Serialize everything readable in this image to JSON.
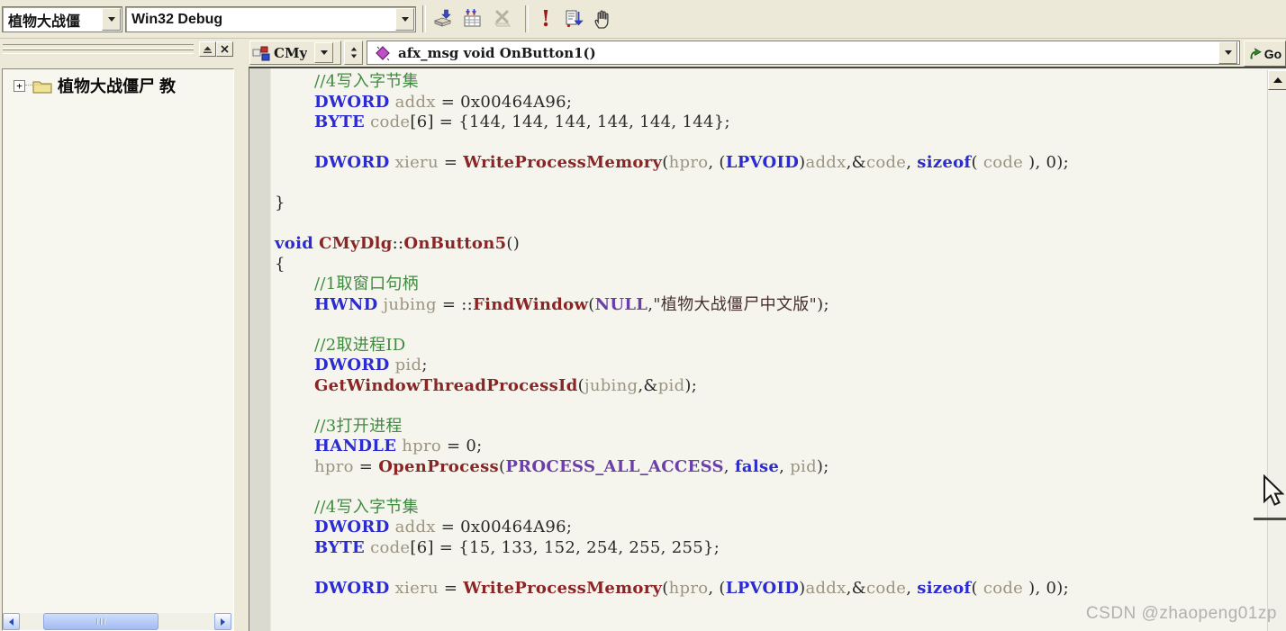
{
  "toolbar": {
    "project_combo_value": "植物大战僵",
    "config_combo_value": "Win32 Debug",
    "icon_names": [
      "build-icon",
      "build-all-icon",
      "stop-build-icon",
      "execute-program-icon",
      "go-debug-icon",
      "hand-breakpoint-icon"
    ]
  },
  "wizardbar": {
    "class_combo_value": "CMy",
    "member_combo_value": "afx_msg void OnButton1()",
    "go_label": "Go",
    "icon_names": [
      "class-icon",
      "member-function-icon",
      "go-arrow-icon"
    ]
  },
  "workspace_tree": {
    "root_label": "植物大战僵尸 教"
  },
  "editor": {
    "syntax_colors": {
      "keyword": "#2B2BD0",
      "function": "#8B2525",
      "identifier": "#9C9480",
      "plain": "#2A2A28",
      "comment": "#3E8A3E",
      "macro": "#6B3FA8",
      "string": "#46302E",
      "background": "#F5F5EE"
    },
    "lines": [
      {
        "ind": 1,
        "t": [
          [
            "c",
            "//4写入字节集"
          ]
        ]
      },
      {
        "ind": 1,
        "t": [
          [
            "k",
            "DWORD"
          ],
          [
            "i",
            " addx "
          ],
          [
            "p",
            "= 0x00464A96;"
          ]
        ]
      },
      {
        "ind": 1,
        "t": [
          [
            "k",
            "BYTE"
          ],
          [
            "i",
            " code"
          ],
          [
            "p",
            "[6] = {144, 144, 144, 144, 144, 144};"
          ]
        ]
      },
      {
        "t": []
      },
      {
        "ind": 1,
        "t": [
          [
            "k",
            "DWORD"
          ],
          [
            "i",
            " xieru "
          ],
          [
            "p",
            "= "
          ],
          [
            "f",
            "WriteProcessMemory"
          ],
          [
            "p",
            "("
          ],
          [
            "i",
            "hpro"
          ],
          [
            "p",
            ", ("
          ],
          [
            "k",
            "LPVOID"
          ],
          [
            "p",
            ")"
          ],
          [
            "i",
            "addx"
          ],
          [
            "p",
            ",&"
          ],
          [
            "i",
            "code"
          ],
          [
            "p",
            ", "
          ],
          [
            "k",
            "sizeof"
          ],
          [
            "p",
            "( "
          ],
          [
            "i",
            "code"
          ],
          [
            "p",
            " ), 0);"
          ]
        ]
      },
      {
        "t": []
      },
      {
        "t": [
          [
            "p",
            "}"
          ]
        ]
      },
      {
        "t": []
      },
      {
        "t": [
          [
            "k",
            "void"
          ],
          [
            "p",
            " "
          ],
          [
            "f",
            "CMyDlg"
          ],
          [
            "p",
            "::"
          ],
          [
            "f",
            "OnButton5"
          ],
          [
            "p",
            "()"
          ]
        ]
      },
      {
        "t": [
          [
            "p",
            "{"
          ]
        ]
      },
      {
        "ind": 1,
        "t": [
          [
            "c",
            "//1取窗口句柄"
          ]
        ]
      },
      {
        "ind": 1,
        "t": [
          [
            "k",
            "HWND"
          ],
          [
            "i",
            " jubing "
          ],
          [
            "p",
            "= ::"
          ],
          [
            "f",
            "FindWindow"
          ],
          [
            "p",
            "("
          ],
          [
            "m",
            "NULL"
          ],
          [
            "p",
            ","
          ],
          [
            "s",
            "\"植物大战僵尸中文版\""
          ],
          [
            "p",
            ");"
          ]
        ]
      },
      {
        "t": []
      },
      {
        "ind": 1,
        "t": [
          [
            "c",
            "//2取进程ID"
          ]
        ]
      },
      {
        "ind": 1,
        "t": [
          [
            "k",
            "DWORD"
          ],
          [
            "i",
            " pid"
          ],
          [
            "p",
            ";"
          ]
        ]
      },
      {
        "ind": 1,
        "t": [
          [
            "f",
            "GetWindowThreadProcessId"
          ],
          [
            "p",
            "("
          ],
          [
            "i",
            "jubing"
          ],
          [
            "p",
            ",&"
          ],
          [
            "i",
            "pid"
          ],
          [
            "p",
            ");"
          ]
        ]
      },
      {
        "t": []
      },
      {
        "ind": 1,
        "t": [
          [
            "c",
            "//3打开进程"
          ]
        ]
      },
      {
        "ind": 1,
        "t": [
          [
            "k",
            "HANDLE"
          ],
          [
            "i",
            " hpro "
          ],
          [
            "p",
            "= 0;"
          ]
        ]
      },
      {
        "ind": 1,
        "t": [
          [
            "i",
            "hpro "
          ],
          [
            "p",
            "= "
          ],
          [
            "f",
            "OpenProcess"
          ],
          [
            "p",
            "("
          ],
          [
            "m",
            "PROCESS_ALL_ACCESS"
          ],
          [
            "p",
            ", "
          ],
          [
            "k",
            "false"
          ],
          [
            "p",
            ", "
          ],
          [
            "i",
            "pid"
          ],
          [
            "p",
            ");"
          ]
        ]
      },
      {
        "t": []
      },
      {
        "ind": 1,
        "t": [
          [
            "c",
            "//4写入字节集"
          ]
        ]
      },
      {
        "ind": 1,
        "t": [
          [
            "k",
            "DWORD"
          ],
          [
            "i",
            " addx "
          ],
          [
            "p",
            "= 0x00464A96;"
          ]
        ]
      },
      {
        "ind": 1,
        "t": [
          [
            "k",
            "BYTE"
          ],
          [
            "i",
            " code"
          ],
          [
            "p",
            "[6] = {15, 133, 152, 254, 255, 255};"
          ]
        ]
      },
      {
        "t": []
      },
      {
        "ind": 1,
        "t": [
          [
            "k",
            "DWORD"
          ],
          [
            "i",
            " xieru "
          ],
          [
            "p",
            "= "
          ],
          [
            "f",
            "WriteProcessMemory"
          ],
          [
            "p",
            "("
          ],
          [
            "i",
            "hpro"
          ],
          [
            "p",
            ", ("
          ],
          [
            "k",
            "LPVOID"
          ],
          [
            "p",
            ")"
          ],
          [
            "i",
            "addx"
          ],
          [
            "p",
            ",&"
          ],
          [
            "i",
            "code"
          ],
          [
            "p",
            ", "
          ],
          [
            "k",
            "sizeof"
          ],
          [
            "p",
            "( "
          ],
          [
            "i",
            "code"
          ],
          [
            "p",
            " ), 0);"
          ]
        ]
      }
    ]
  },
  "watermark": "CSDN @zhaopeng01zp"
}
